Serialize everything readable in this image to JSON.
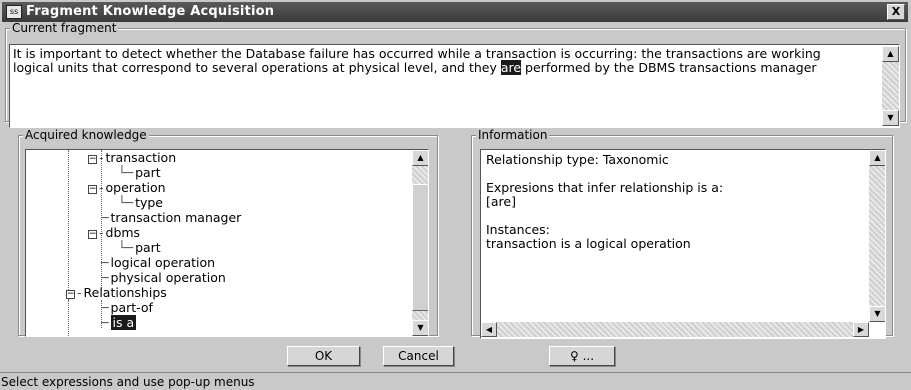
{
  "window": {
    "title": "Fragment Knowledge Acquisition",
    "close_label": "X",
    "icon_label": "ss"
  },
  "current_fragment": {
    "legend": "Current fragment",
    "text_before": "It is important to detect whether the Database failure has occurred while a transaction is occurring: the transactions are working logical units that correspond to several operations at physical level, and they ",
    "highlighted": "are",
    "text_after": " performed by the DBMS transactions manager"
  },
  "acquired_knowledge": {
    "legend": "Acquired knowledge",
    "tree": [
      {
        "label": "transaction",
        "type": "expanded"
      },
      {
        "label": "part",
        "type": "leaf-last"
      },
      {
        "label": "operation",
        "type": "expanded"
      },
      {
        "label": "type",
        "type": "leaf-last"
      },
      {
        "label": "transaction manager",
        "type": "leaf"
      },
      {
        "label": "dbms",
        "type": "expanded"
      },
      {
        "label": "part",
        "type": "leaf-last"
      },
      {
        "label": "logical operation",
        "type": "leaf"
      },
      {
        "label": "physical operation",
        "type": "leaf"
      },
      {
        "label": "Relationships",
        "type": "expanded"
      },
      {
        "label": "part-of",
        "type": "leaf"
      },
      {
        "label": "is a",
        "type": "leaf-selected"
      }
    ]
  },
  "information": {
    "legend": "Information",
    "relationship_type": "Relationship type: Taxonomic",
    "expressions_label": "Expresions that infer relationship is a:",
    "expressions_value": "[are]",
    "instances_label": "Instances:",
    "instances_value": "transaction is a logical operation"
  },
  "buttons": {
    "ok": "OK",
    "cancel": "Cancel",
    "help": "♀ ..."
  },
  "status": {
    "text": "Select expressions and use pop-up menus"
  }
}
